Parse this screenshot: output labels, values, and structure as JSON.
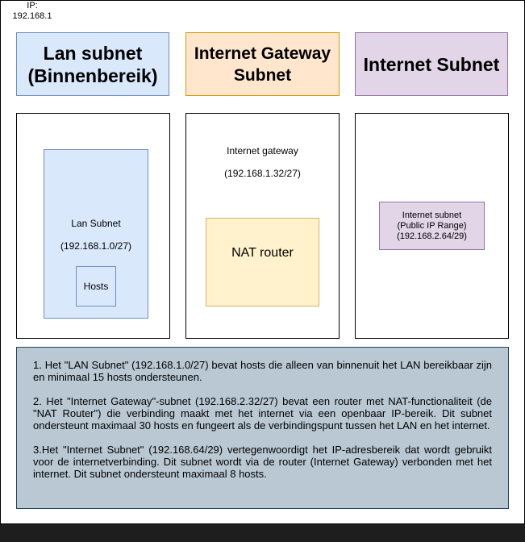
{
  "ip_label": "IP:\n192.168.1",
  "headers": {
    "lan": "Lan subnet (Binnenbereik)",
    "gateway": "Internet Gateway Subnet",
    "internet": "Internet Subnet"
  },
  "lan_panel": {
    "title": "Lan Subnet",
    "range": "(192.168.1.0/27)",
    "hosts": "Hosts"
  },
  "gateway_panel": {
    "title": "Internet gateway",
    "range": "(192.168.1.32/27)",
    "nat": "NAT router"
  },
  "internet_panel": {
    "line1": "Internet subnet",
    "line2": "(Public IP Range)",
    "line3": "(192.168.2.64/29)"
  },
  "notes": [
    "1. Het \"LAN Subnet\" (192.168.1.0/27) bevat hosts die alleen van binnenuit het LAN bereikbaar zijn en minimaal 15 hosts ondersteunen.",
    "2. Het \"Internet Gateway\"-subnet (192.168.2.32/27) bevat een router met NAT-functionaliteit (de \"NAT Router\") die verbinding maakt met het internet via een openbaar IP-bereik. Dit subnet ondersteunt maximaal 30 hosts en fungeert als de verbindingspunt tussen het LAN en het internet.",
    "3.Het \"Internet Subnet\" (192.168.64/29) vertegenwoordigt het IP-adresbereik dat wordt gebruikt voor de internetverbinding. Dit subnet wordt via de router (Internet Gateway) verbonden met het internet. Dit subnet ondersteunt maximaal 8 hosts."
  ]
}
